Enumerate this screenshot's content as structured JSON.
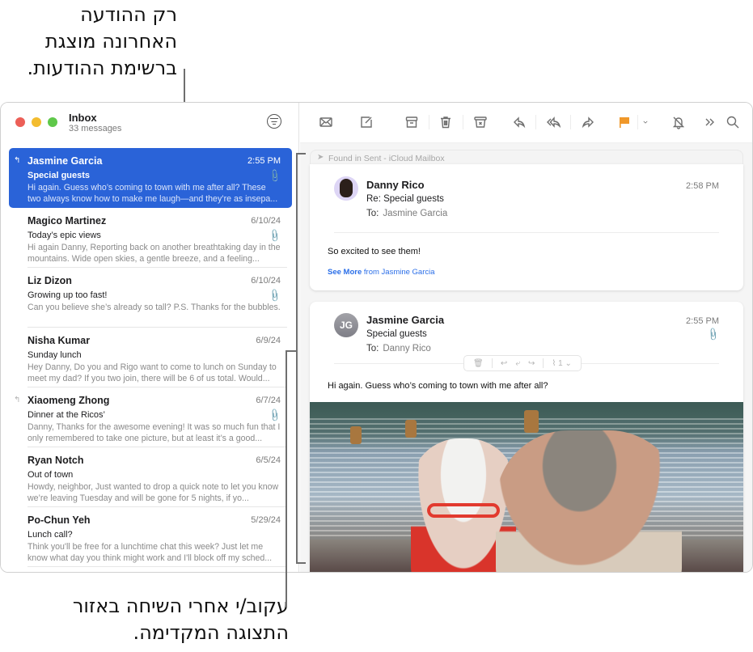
{
  "callouts": {
    "top": [
      "רק ההודעה",
      "האחרונה מוצגת",
      "ברשימת ההודעות."
    ],
    "bottom": [
      "עקוב/י אחרי השיחה באזור",
      "התצוגה המקדימה."
    ]
  },
  "mailbox": {
    "title": "Inbox",
    "count": "33 messages"
  },
  "messages": [
    {
      "from": "Jasmine Garcia",
      "date": "2:55 PM",
      "subject": "Special guests",
      "preview": "Hi again. Guess who’s coming to town with me after all? These two always know how to make me laugh—and they’re as insepa...",
      "replied": true,
      "attachment": true,
      "selected": true
    },
    {
      "from": "Magico Martinez",
      "date": "6/10/24",
      "subject": "Today’s epic views",
      "preview": "Hi again Danny, Reporting back on another breathtaking day in the mountains. Wide open skies, a gentle breeze, and a feeling...",
      "replied": false,
      "attachment": true
    },
    {
      "from": "Liz Dizon",
      "date": "6/10/24",
      "subject": "Growing up too fast!",
      "preview": "Can you believe she’s already so tall? P.S. Thanks for the bubbles.",
      "replied": false,
      "attachment": true
    },
    {
      "from": "Nisha Kumar",
      "date": "6/9/24",
      "subject": "Sunday lunch",
      "preview": "Hey Danny, Do you and Rigo want to come to lunch on Sunday to meet my dad? If you two join, there will be 6 of us total. Would...",
      "replied": false,
      "attachment": false
    },
    {
      "from": "Xiaomeng Zhong",
      "date": "6/7/24",
      "subject": "Dinner at the Ricos’",
      "preview": "Danny, Thanks for the awesome evening! It was so much fun that I only remembered to take one picture, but at least it’s a good...",
      "replied": true,
      "attachment": true
    },
    {
      "from": "Ryan Notch",
      "date": "6/5/24",
      "subject": "Out of town",
      "preview": "Howdy, neighbor, Just wanted to drop a quick note to let you know we’re leaving Tuesday and will be gone for 5 nights, if yo...",
      "replied": false,
      "attachment": false
    },
    {
      "from": "Po-Chun Yeh",
      "date": "5/29/24",
      "subject": "Lunch call?",
      "preview": "Think you'll be free for a lunchtime chat this week? Just let me know what day you think might work and I'll block off my sched...",
      "replied": false,
      "attachment": false
    }
  ],
  "toolbar": {
    "icons": [
      "envelope-icon",
      "compose-icon",
      "archive-icon",
      "trash-icon",
      "junk-icon",
      "reply-icon",
      "reply-all-icon",
      "forward-icon",
      "flag-icon",
      "flag-menu-chevron-icon",
      "mute-icon",
      "more-icon",
      "search-icon"
    ],
    "flag_color": "#f0982a"
  },
  "preview": {
    "found_in": "Found in Sent - iCloud Mailbox",
    "reply": {
      "from": "Danny Rico",
      "subject": "Re: Special guests",
      "to_label": "To:",
      "to": "Jasmine Garcia",
      "time": "2:58 PM",
      "body": "So excited to see them!",
      "see_more": "See More",
      "see_more_from": "from Jasmine Garcia"
    },
    "original": {
      "initials": "JG",
      "from": "Jasmine Garcia",
      "subject": "Special guests",
      "to_label": "To:",
      "to": "Danny Rico",
      "time": "2:55 PM",
      "body": "Hi again. Guess who’s coming to town with me after all?",
      "attachment_count": "1"
    }
  },
  "colors": {
    "selection": "#2a63d8",
    "link": "#2a6ee8",
    "close": "#ec5f57",
    "minimize": "#f3bc2f",
    "zoom": "#5fc84a"
  }
}
